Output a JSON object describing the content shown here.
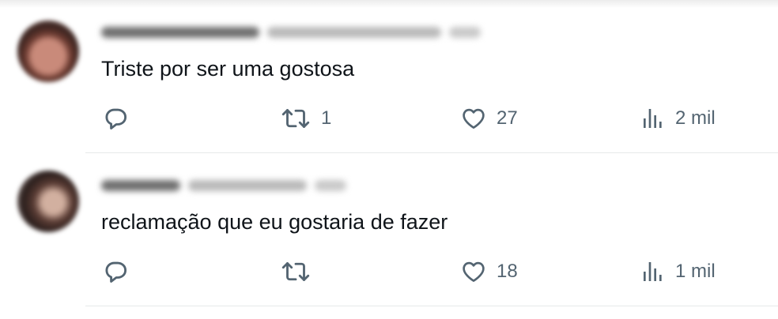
{
  "tweets": [
    {
      "text": "Triste por ser uma gostosa",
      "retweets": "1",
      "likes": "27",
      "views": "2 mil"
    },
    {
      "text": "reclamação que eu gostaria de fazer",
      "retweets": "",
      "likes": "18",
      "views": "1 mil"
    }
  ],
  "colors": {
    "text": "#0f1419",
    "action": "#536471",
    "divider": "#e6e9ea"
  },
  "icons": [
    "reply-icon",
    "retweet-icon",
    "like-icon",
    "views-icon"
  ]
}
